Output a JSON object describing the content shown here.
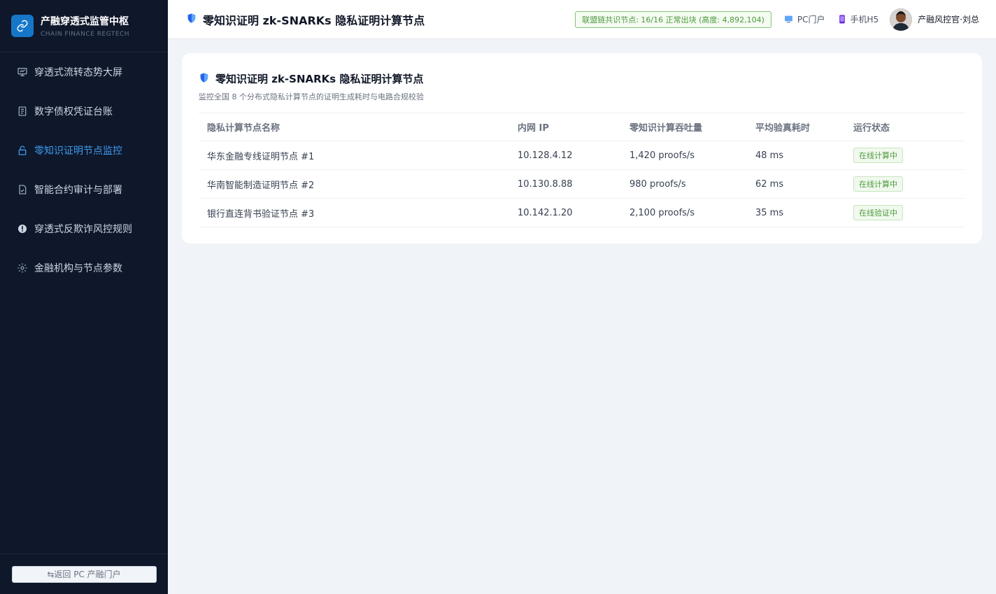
{
  "brand": {
    "title": "产融穿透式监管中枢",
    "subtitle": "CHAIN FINANCE REGTECH"
  },
  "sidebar": {
    "items": [
      {
        "label": "穿透式流转态势大屏",
        "icon": "presentation-icon",
        "active": false
      },
      {
        "label": "数字债权凭证台账",
        "icon": "document-icon",
        "active": false
      },
      {
        "label": "零知识证明节点监控",
        "icon": "lock-icon",
        "active": true
      },
      {
        "label": "智能合约审计与部署",
        "icon": "file-check-icon",
        "active": false
      },
      {
        "label": "穿透式反欺诈风控规则",
        "icon": "alert-circle-icon",
        "active": false
      },
      {
        "label": "金融机构与节点参数",
        "icon": "gear-icon",
        "active": false
      }
    ],
    "footer_button": "⇆返回 PC 产融门户"
  },
  "header": {
    "title": "零知识证明 zk-SNARKs 隐私证明计算节点",
    "chain_status": "联盟链共识节点: 16/16 正常出块 (高度: 4,892,104)",
    "links": [
      {
        "label": "PC门户",
        "icon": "monitor-icon"
      },
      {
        "label": "手机H5",
        "icon": "mobile-icon"
      }
    ],
    "user": "产融风控官·刘总"
  },
  "card": {
    "title": "零知识证明 zk-SNARKs 隐私证明计算节点",
    "subtitle": "监控全国 8 个分布式隐私计算节点的证明生成耗时与电路合规校验",
    "columns": [
      "隐私计算节点名称",
      "内网 IP",
      "零知识计算吞吐量",
      "平均验真耗时",
      "运行状态"
    ],
    "rows": [
      {
        "name": "华东金融专线证明节点 #1",
        "ip": "10.128.4.12",
        "throughput": "1,420 proofs/s",
        "latency": "48 ms",
        "status": "在线计算中"
      },
      {
        "name": "华南智能制造证明节点 #2",
        "ip": "10.130.8.88",
        "throughput": "980 proofs/s",
        "latency": "62 ms",
        "status": "在线计算中"
      },
      {
        "name": "银行直连背书验证节点 #3",
        "ip": "10.142.1.20",
        "throughput": "2,100 proofs/s",
        "latency": "35 ms",
        "status": "在线验证中"
      }
    ]
  },
  "colors": {
    "sidebar_bg": "#0f172a",
    "accent": "#3b9cf0",
    "status_green": "#4d9a3d"
  }
}
